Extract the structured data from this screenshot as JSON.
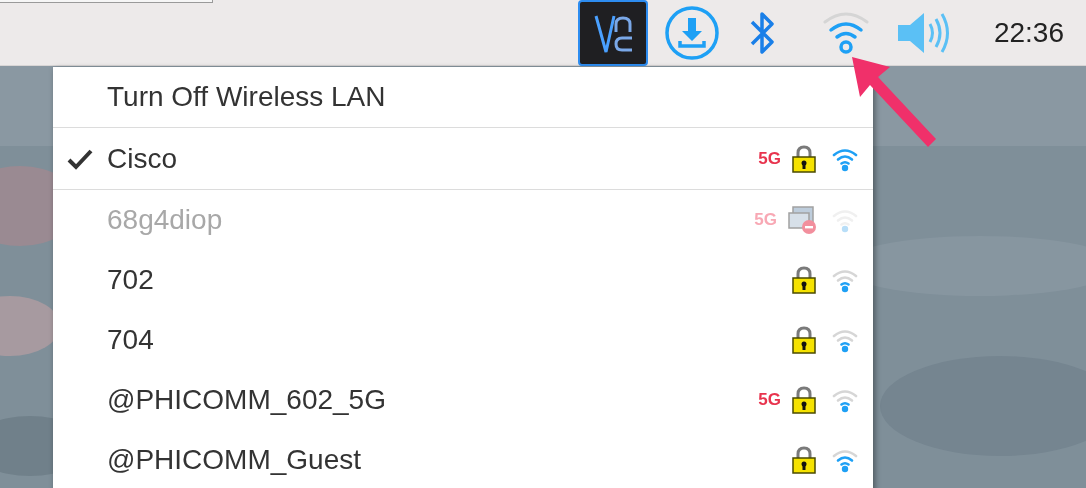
{
  "taskbar": {
    "clock": "22:36"
  },
  "wifi_menu": {
    "toggle": "Turn Off Wireless LAN",
    "networks": [
      {
        "name": "Cisco",
        "selected": true,
        "disabled": false,
        "band": "5G",
        "locked": true,
        "fair_signal": true,
        "strong_signal": true
      },
      {
        "name": "68g4diop",
        "selected": false,
        "disabled": true,
        "band": "5G",
        "locked": false
      },
      {
        "name": "702",
        "selected": false,
        "disabled": false,
        "locked": true,
        "fair_signal": false,
        "strong_signal": false
      },
      {
        "name": "704",
        "selected": false,
        "disabled": false,
        "locked": true,
        "fair_signal": false,
        "strong_signal": false
      },
      {
        "name": "@PHICOMM_602_5G",
        "selected": false,
        "disabled": false,
        "band": "5G",
        "locked": true,
        "fair_signal": false,
        "strong_signal": false
      },
      {
        "name": "@PHICOMM_Guest",
        "selected": false,
        "disabled": false,
        "locked": true,
        "fair_signal": true,
        "strong_signal": false
      }
    ]
  }
}
